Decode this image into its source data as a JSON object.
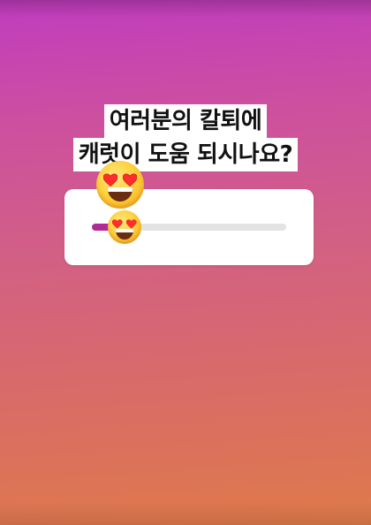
{
  "question": {
    "line1": "여러분의 칼퇴에",
    "line2": "캐럿이 도움 되시나요?"
  },
  "slider": {
    "value_percent": 17,
    "emoji": "heart-eyes-emoji",
    "fill_color": "#b02b98",
    "track_color": "#e3e3e3"
  },
  "sticker_emoji": "heart-eyes-emoji",
  "background": {
    "gradient_top": "#c03cbf",
    "gradient_bottom": "#df7a4a"
  }
}
